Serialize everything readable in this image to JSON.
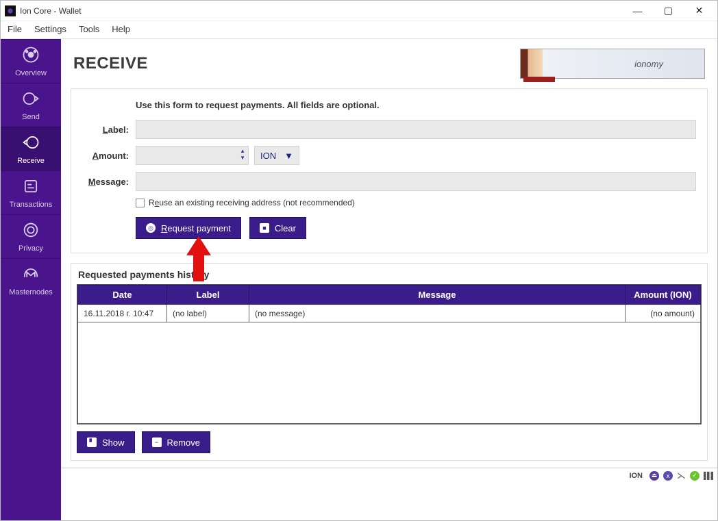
{
  "window": {
    "title": "Ion Core - Wallet"
  },
  "menubar": [
    "File",
    "Settings",
    "Tools",
    "Help"
  ],
  "sidebar": {
    "items": [
      {
        "label": "Overview"
      },
      {
        "label": "Send"
      },
      {
        "label": "Receive"
      },
      {
        "label": "Transactions"
      },
      {
        "label": "Privacy"
      },
      {
        "label": "Masternodes"
      }
    ],
    "active_index": 2
  },
  "banner": {
    "text": "ionomy"
  },
  "page": {
    "title": "RECEIVE",
    "form_intro": "Use this form to request payments. All fields are optional.",
    "labels": {
      "label_u": "L",
      "label_rest": "abel:",
      "amount_u": "A",
      "amount_rest": "mount:",
      "message_u": "M",
      "message_rest": "essage:"
    },
    "inputs": {
      "label_value": "",
      "amount_value": "",
      "currency": "ION",
      "message_value": ""
    },
    "reuse_checkbox": {
      "pre": "R",
      "u": "e",
      "post": "use an existing receiving address (not recommended)",
      "checked": false
    },
    "buttons": {
      "request_u": "R",
      "request_rest": "equest payment",
      "clear": "Clear"
    }
  },
  "history": {
    "title": "Requested payments history",
    "columns": [
      "Date",
      "Label",
      "Message",
      "Amount (ION)"
    ],
    "col_widths": [
      "130px",
      "120px",
      "auto",
      "110px"
    ],
    "rows": [
      {
        "date": "16.11.2018 г. 10:47",
        "label": "(no label)",
        "message": "(no message)",
        "amount": "(no amount)"
      }
    ],
    "buttons": {
      "show": "Show",
      "remove": "Remove"
    }
  },
  "statusbar": {
    "coin": "ION"
  }
}
